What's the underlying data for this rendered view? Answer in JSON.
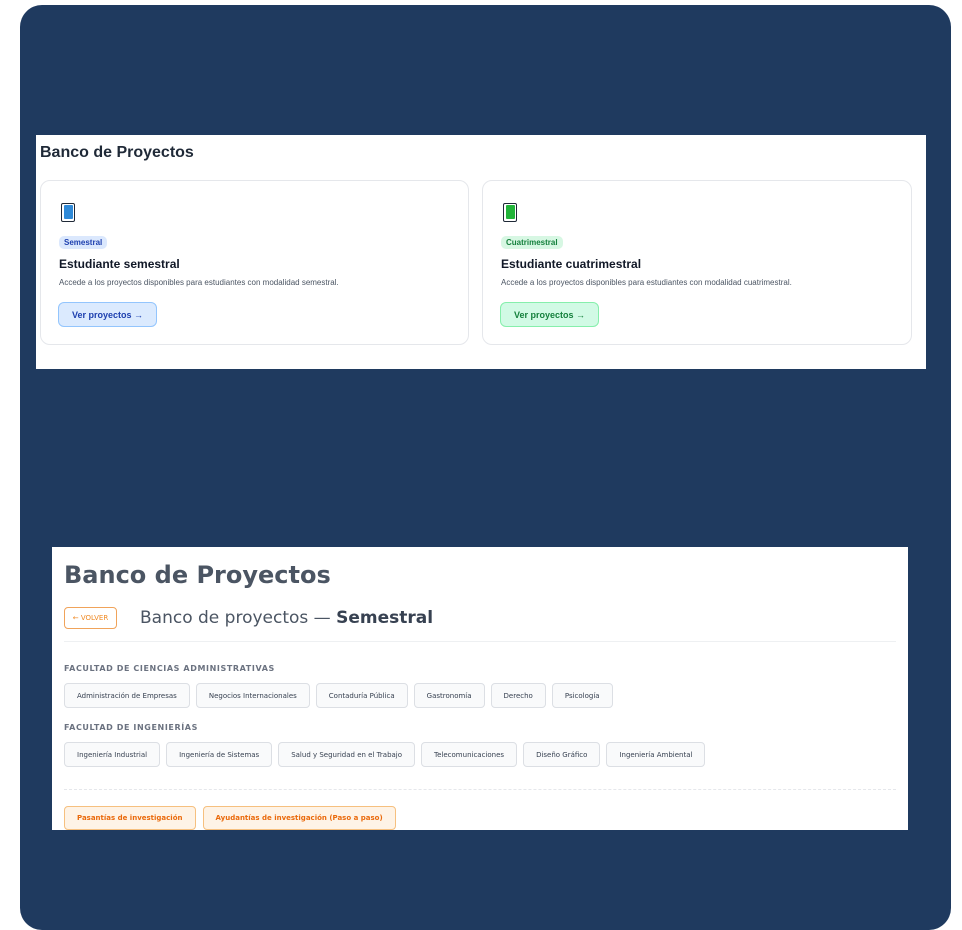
{
  "panel_selector": {
    "title": "Banco de Proyectos",
    "cards": [
      {
        "icon": "blue-book-icon",
        "badge": "Semestral",
        "heading": "Estudiante semestral",
        "description": "Accede a los proyectos disponibles para estudiantes con modalidad semestral.",
        "button": "Ver proyectos →",
        "accent": "#1e40af"
      },
      {
        "icon": "green-book-icon",
        "badge": "Cuatrimestral",
        "heading": "Estudiante cuatrimestral",
        "description": "Accede a los proyectos disponibles para estudiantes con modalidad cuatrimestral.",
        "button": "Ver proyectos →",
        "accent": "#15803d"
      }
    ]
  },
  "panel_programs": {
    "title": "Banco de Proyectos",
    "back_button": "← VOLVER",
    "subtitle_prefix": "Banco de proyectos — ",
    "subtitle_bold": "Semestral",
    "faculties": [
      {
        "name": "FACULTAD DE CIENCIAS ADMINISTRATIVAS",
        "programs": [
          "Administración de Empresas",
          "Negocios Internacionales",
          "Contaduría Pública",
          "Gastronomía",
          "Derecho",
          "Psicología"
        ]
      },
      {
        "name": "FACULTAD DE INGENIERÍAS",
        "programs": [
          "Ingeniería Industrial",
          "Ingeniería de Sistemas",
          "Salud y Seguridad en el Trabajo",
          "Telecomunicaciones",
          "Diseño Gráfico",
          "Ingeniería Ambiental"
        ]
      }
    ],
    "extra_links": [
      "Pasantías de investigación",
      "Ayudantías de investigación (Paso a paso)"
    ]
  },
  "colors": {
    "background": "#1f3a5f",
    "orange_accent": "#ea6a0c"
  }
}
